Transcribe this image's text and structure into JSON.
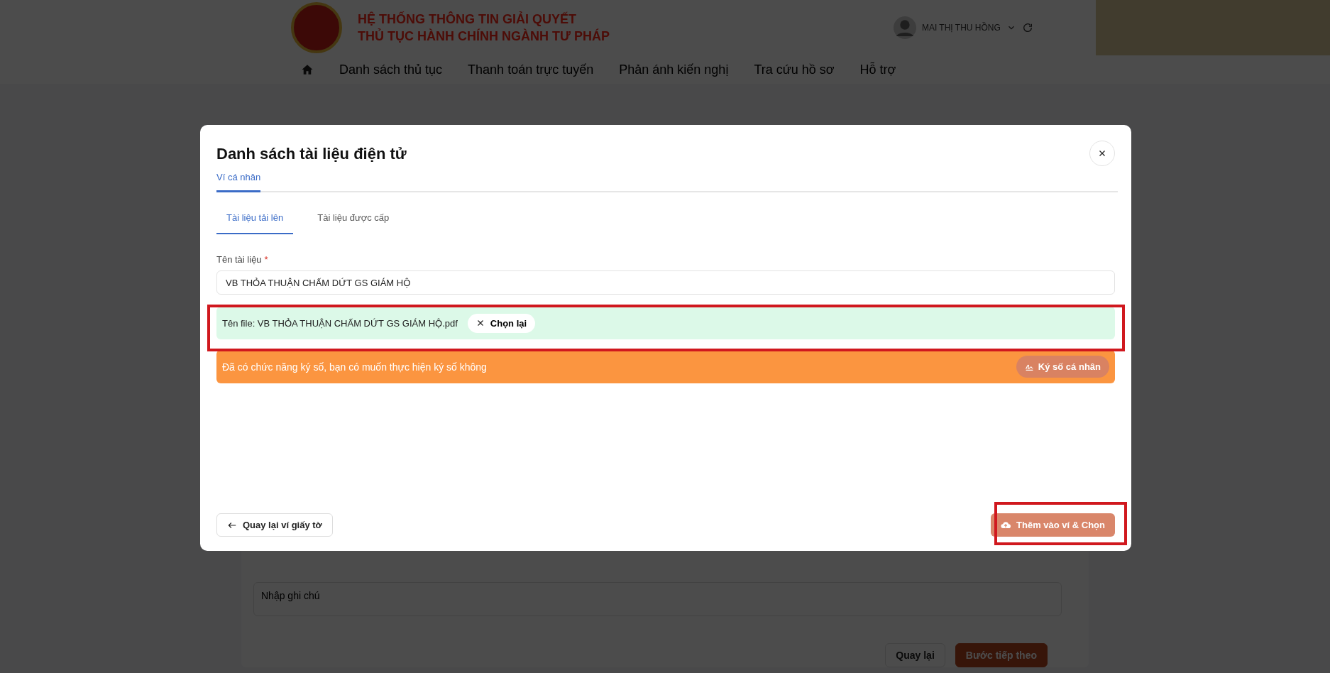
{
  "header": {
    "title_lines": [
      "HỆ THỐNG THÔNG TIN GIẢI QUYẾT",
      "THỦ TỤC HÀNH CHÍNH NGÀNH TƯ PHÁP"
    ],
    "user_name": "MAI THỊ THU HỒNG"
  },
  "nav": {
    "items": [
      "Danh sách thủ tục",
      "Thanh toán trực tuyến",
      "Phản ánh kiến nghị",
      "Tra cứu hồ sơ",
      "Hỗ trợ"
    ]
  },
  "background_form": {
    "note_placeholder": "Nhập ghi chú",
    "back_button": "Quay lại",
    "next_button": "Bước tiếp theo"
  },
  "modal": {
    "title": "Danh sách tài liệu điện tử",
    "tabs": [
      {
        "label": "Ví cá nhân",
        "selected": true
      }
    ],
    "subtabs": [
      {
        "label": "Tài liệu tải lên",
        "selected": true
      },
      {
        "label": "Tài liệu được cấp",
        "selected": false
      }
    ],
    "field": {
      "label": "Tên tài liệu",
      "required_mark": "*",
      "value": "VB THỎA THUẬN CHẤM DỨT GS GIÁM HỘ"
    },
    "file": {
      "text": "Tên file: VB THỎA THUẬN CHẤM DỨT GS GIÁM HỘ.pdf",
      "reselect_button": "Chọn lại"
    },
    "sign_banner": {
      "text": "Đã có chức năng ký số, bạn có muốn thực hiện ký số không",
      "button": "Ký số cá nhân"
    },
    "back_button": "Quay lại ví giấy tờ",
    "submit_button": "Thêm vào ví & Chọn"
  }
}
